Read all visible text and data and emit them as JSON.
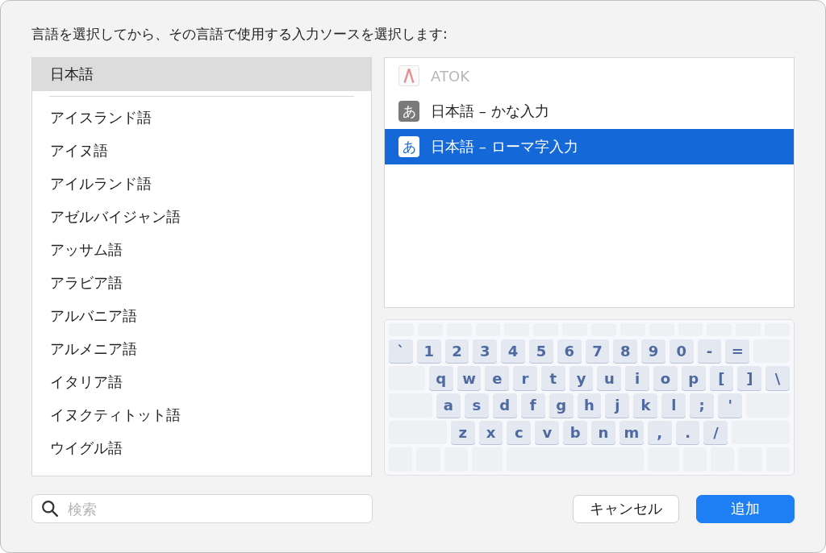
{
  "prompt": "言語を選択してから、その言語で使用する入力ソースを選択します:",
  "languages": [
    {
      "label": "日本語",
      "selected": true
    },
    {
      "kind": "separator"
    },
    {
      "label": "アイスランド語",
      "selected": false
    },
    {
      "label": "アイヌ語",
      "selected": false
    },
    {
      "label": "アイルランド語",
      "selected": false
    },
    {
      "label": "アゼルバイジャン語",
      "selected": false
    },
    {
      "label": "アッサム語",
      "selected": false
    },
    {
      "label": "アラビア語",
      "selected": false
    },
    {
      "label": "アルバニア語",
      "selected": false
    },
    {
      "label": "アルメニア語",
      "selected": false
    },
    {
      "label": "イタリア語",
      "selected": false
    },
    {
      "label": "イヌクティトット語",
      "selected": false
    },
    {
      "label": "ウイグル語",
      "selected": false
    }
  ],
  "input_sources": [
    {
      "label": "ATOK",
      "kind": "atok",
      "disabled": true,
      "selected": false
    },
    {
      "label": "日本語 – かな入力",
      "kind": "kana",
      "icon_text": "あ",
      "disabled": false,
      "selected": false
    },
    {
      "label": "日本語 – ローマ字入力",
      "kind": "kana",
      "icon_text": "あ",
      "disabled": false,
      "selected": true
    }
  ],
  "keyboard": {
    "rows": [
      [
        "`",
        "1",
        "2",
        "3",
        "4",
        "5",
        "6",
        "7",
        "8",
        "9",
        "0",
        "-",
        "="
      ],
      [
        "q",
        "w",
        "e",
        "r",
        "t",
        "y",
        "u",
        "i",
        "o",
        "p",
        "[",
        "]",
        "\\"
      ],
      [
        "a",
        "s",
        "d",
        "f",
        "g",
        "h",
        "j",
        "k",
        "l",
        ";",
        "'"
      ],
      [
        "z",
        "x",
        "c",
        "v",
        "b",
        "n",
        "m",
        ",",
        ".",
        "/"
      ]
    ]
  },
  "search": {
    "placeholder": "検索"
  },
  "buttons": [
    {
      "label": "キャンセル",
      "kind": "secondary"
    },
    {
      "label": "追加",
      "kind": "primary"
    }
  ]
}
